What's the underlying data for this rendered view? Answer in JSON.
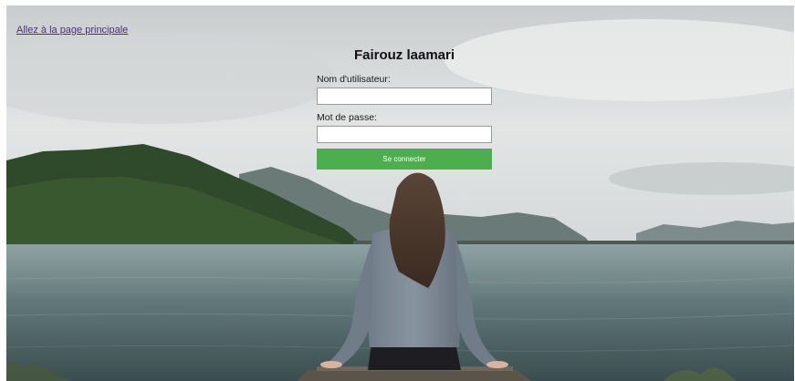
{
  "links": {
    "home": "Allez à la page principale"
  },
  "login": {
    "title": "Fairouz laamari",
    "username_label": "Nom d'utilisateur:",
    "username_value": "",
    "password_label": "Mot de passe:",
    "password_value": "",
    "submit_label": "Se connecter"
  },
  "colors": {
    "button": "#4cae4c",
    "link": "#4b2e83"
  }
}
